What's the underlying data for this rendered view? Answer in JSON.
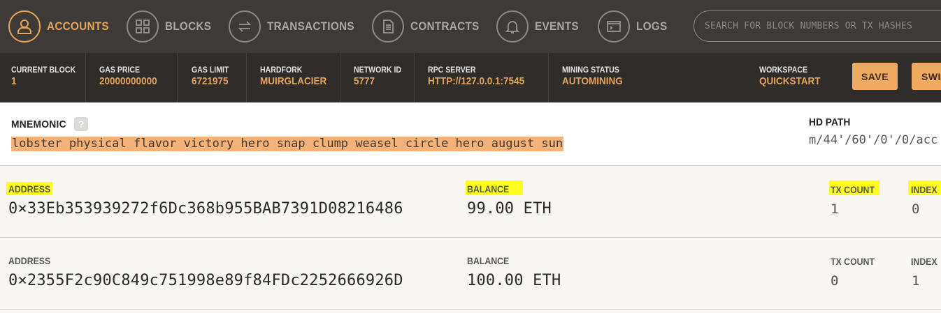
{
  "nav": {
    "items": [
      {
        "label": "ACCOUNTS",
        "icon": "account-icon",
        "active": true
      },
      {
        "label": "BLOCKS",
        "icon": "blocks-icon",
        "active": false
      },
      {
        "label": "TRANSACTIONS",
        "icon": "transactions-icon",
        "active": false
      },
      {
        "label": "CONTRACTS",
        "icon": "contracts-icon",
        "active": false
      },
      {
        "label": "EVENTS",
        "icon": "bell-icon",
        "active": false
      },
      {
        "label": "LOGS",
        "icon": "terminal-icon",
        "active": false
      }
    ],
    "search_placeholder": "SEARCH FOR BLOCK NUMBERS OR TX HASHES"
  },
  "status": {
    "current_block": {
      "label": "CURRENT BLOCK",
      "value": "1"
    },
    "gas_price": {
      "label": "GAS PRICE",
      "value": "20000000000"
    },
    "gas_limit": {
      "label": "GAS LIMIT",
      "value": "6721975"
    },
    "hardfork": {
      "label": "HARDFORK",
      "value": "MUIRGLACIER"
    },
    "network_id": {
      "label": "NETWORK ID",
      "value": "5777"
    },
    "rpc_server": {
      "label": "RPC SERVER",
      "value": "HTTP://127.0.0.1:7545"
    },
    "mining_status": {
      "label": "MINING STATUS",
      "value": "AUTOMINING"
    },
    "workspace": {
      "label": "WORKSPACE",
      "value": "QUICKSTART"
    },
    "save_label": "SAVE",
    "switch_label": "SWIT"
  },
  "mnemonic": {
    "title": "MNEMONIC",
    "help": "?",
    "words": "lobster physical flavor victory hero snap clump weasel circle hero august sun",
    "hd_path_title": "HD PATH",
    "hd_path": "m/44'/60'/0'/0/acc"
  },
  "labels": {
    "address": "ADDRESS",
    "balance": "BALANCE",
    "tx_count": "TX COUNT",
    "index": "INDEX"
  },
  "accounts": [
    {
      "address": "0×33Eb353939272f6Dc368b955BAB7391D08216486",
      "balance": "99.00 ETH",
      "tx_count": "1",
      "index": "0"
    },
    {
      "address": "0×2355F2c90C849c751998e89f84FDc2252666926D",
      "balance": "100.00 ETH",
      "tx_count": "0",
      "index": "1"
    }
  ],
  "colors": {
    "accent": "#e5a45a",
    "nav_bg": "#3e3a37",
    "status_bg": "#2f2c2a",
    "mnemonic_highlight": "#f2b27a",
    "marker_highlight": "#ffff1e"
  }
}
